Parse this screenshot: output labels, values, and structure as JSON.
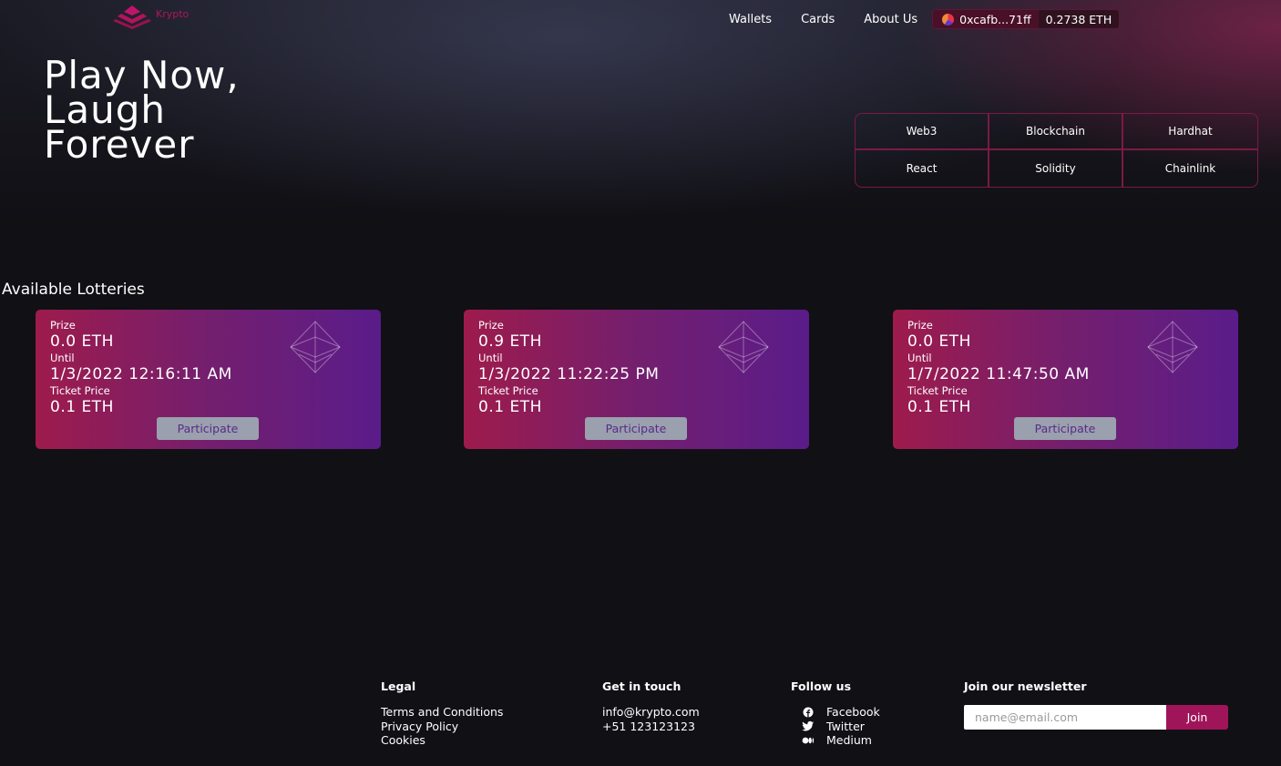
{
  "header": {
    "logo_text": "Krypto",
    "nav": {
      "wallets": "Wallets",
      "cards": "Cards",
      "about": "About Us"
    },
    "wallet": {
      "address": "0xcafb...71ff",
      "balance": "0.2738 ETH"
    }
  },
  "hero": {
    "title_lines": [
      "Play Now,",
      "Laugh",
      "Forever"
    ],
    "tech": [
      "Web3",
      "Blockchain",
      "Hardhat",
      "React",
      "Solidity",
      "Chainlink"
    ]
  },
  "lotteries": {
    "title": "Available Lotteries",
    "labels": {
      "prize": "Prize",
      "until": "Until",
      "ticket": "Ticket Price",
      "button": "Participate"
    },
    "items": [
      {
        "prize": "0.0 ETH",
        "until": "1/3/2022 12:16:11 AM",
        "ticket": "0.1 ETH"
      },
      {
        "prize": "0.9 ETH",
        "until": "1/3/2022 11:22:25 PM",
        "ticket": "0.1 ETH"
      },
      {
        "prize": "0.0 ETH",
        "until": "1/7/2022 11:47:50 AM",
        "ticket": "0.1 ETH"
      }
    ]
  },
  "footer": {
    "legal": {
      "title": "Legal",
      "links": [
        "Terms and Conditions",
        "Privacy Policy",
        "Cookies"
      ]
    },
    "contact": {
      "title": "Get in touch",
      "email": "info@krypto.com",
      "phone": "+51 123123123"
    },
    "social": {
      "title": "Follow us",
      "links": [
        {
          "icon": "facebook-icon",
          "label": "Facebook"
        },
        {
          "icon": "twitter-icon",
          "label": "Twitter"
        },
        {
          "icon": "medium-icon",
          "label": "Medium"
        }
      ]
    },
    "newsletter": {
      "title": "Join our newsletter",
      "placeholder": "name@email.com",
      "button": "Join"
    }
  },
  "colors": {
    "background": "#111015",
    "accent": "#a0145a",
    "card_start": "#9e1b4c",
    "card_end": "#5a1c8a",
    "button": "#9aa0ad"
  }
}
